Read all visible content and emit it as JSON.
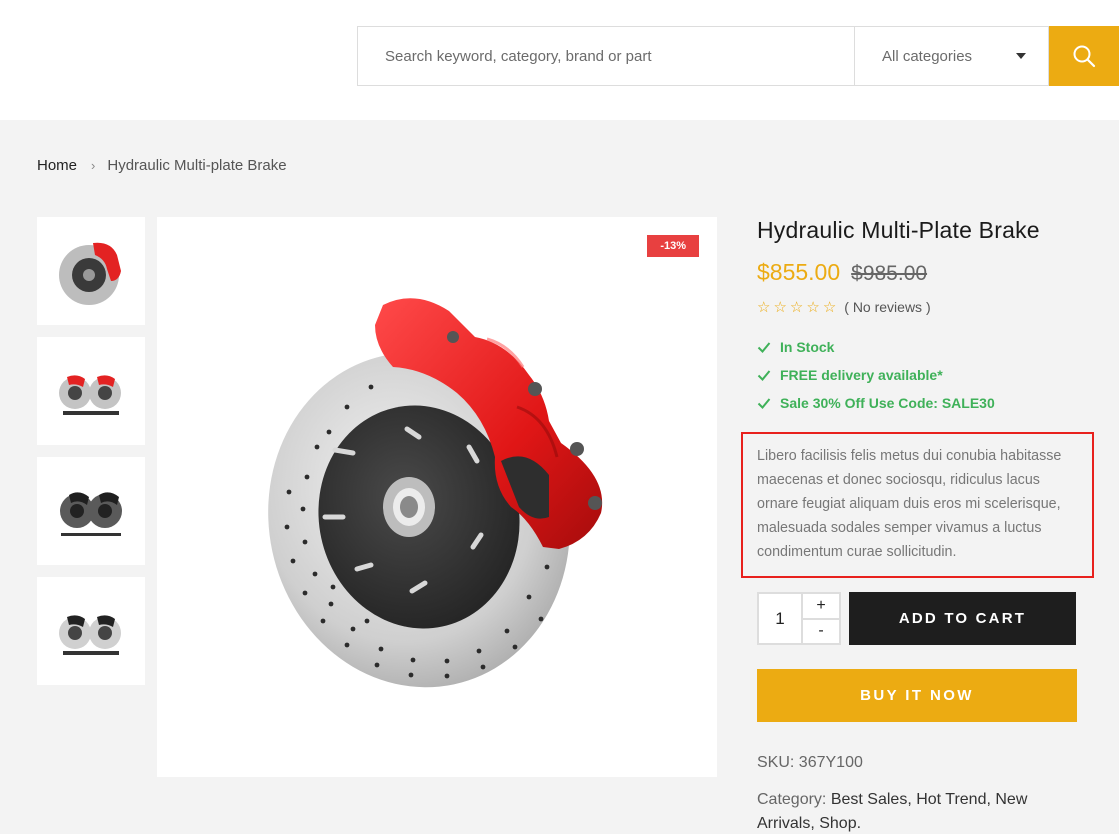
{
  "search": {
    "placeholder": "Search keyword, category, brand or part",
    "category": "All categories"
  },
  "breadcrumb": {
    "home": "Home",
    "current": "Hydraulic Multi-plate Brake"
  },
  "gallery": {
    "badge": "-13%",
    "thumbnails": [
      "single-red-caliper-disc",
      "pair-red-caliper-discs",
      "pair-black-caliper-discs",
      "pair-black-caliper-discs-2"
    ]
  },
  "product": {
    "title": "Hydraulic Multi-Plate Brake",
    "price": "$855.00",
    "old_price": "$985.00",
    "rating": 0,
    "reviews": "( No reviews )",
    "features": [
      "In Stock",
      "FREE delivery available*",
      "Sale 30% Off Use Code: SALE30"
    ],
    "description": "Libero facilisis felis metus dui conubia habitasse maecenas et donec sociosqu, ridiculus lacus ornare feugiat aliquam duis eros mi scelerisque, malesuada sodales semper vivamus a luctus condimentum curae sollicitudin.",
    "quantity": "1",
    "qty_plus": "+",
    "qty_minus": "-",
    "add_to_cart": "ADD TO CART",
    "buy_now": "BUY IT NOW",
    "sku_label": "SKU:",
    "sku": "367Y100",
    "category_label": "Category:",
    "categories": [
      "Best Sales,",
      "Hot Trend,",
      "New",
      "Arrivals,",
      "Shop."
    ]
  },
  "colors": {
    "accent": "#ecab12",
    "success": "#3fb159",
    "sale": "#e84040",
    "highlight_border": "#e8201c"
  }
}
